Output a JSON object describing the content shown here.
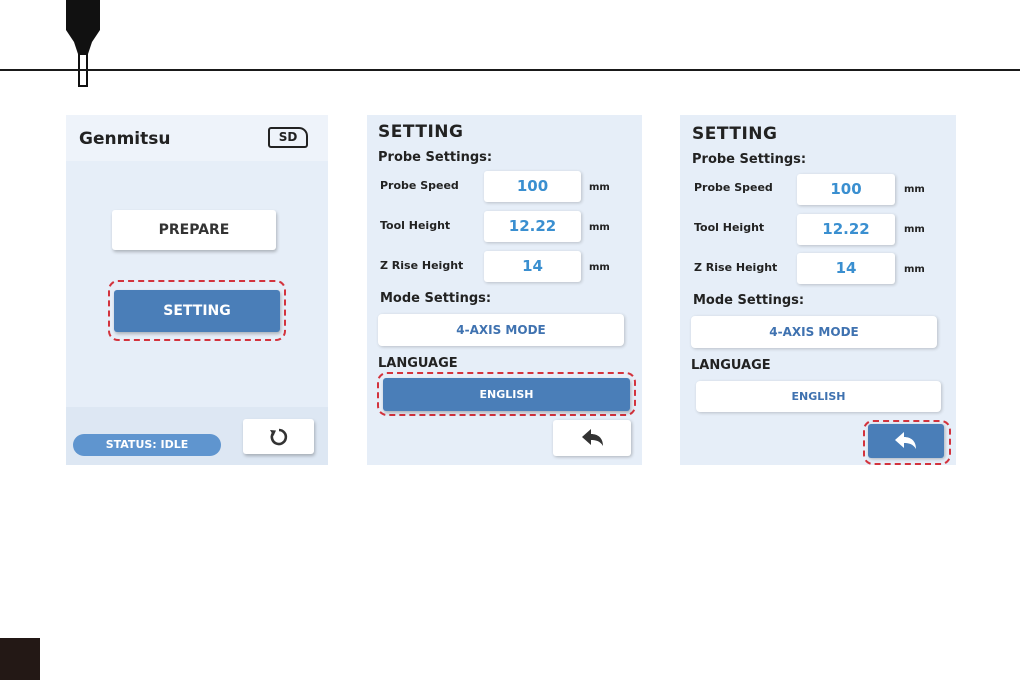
{
  "home": {
    "brand": "Genmitsu",
    "sd_badge": "SD",
    "prepare_label": "PREPARE",
    "setting_label": "SETTING",
    "status_label": "STATUS: IDLE",
    "refresh_icon": "refresh-icon"
  },
  "setting_screens": [
    {
      "title": "SETTING",
      "probe_heading": "Probe Settings:",
      "rows": [
        {
          "label": "Probe Speed",
          "value": "100",
          "unit": "mm"
        },
        {
          "label": "Tool Height",
          "value": "12.22",
          "unit": "mm"
        },
        {
          "label": "Z Rise Height",
          "value": "14",
          "unit": "mm"
        }
      ],
      "mode_heading": "Mode Settings:",
      "mode_value": "4-AXIS MODE",
      "language_heading": "LANGUAGE",
      "language_value": "ENGLISH",
      "back_icon": "back-arrow-icon"
    },
    {
      "title": "SETTING",
      "probe_heading": "Probe Settings:",
      "rows": [
        {
          "label": "Probe Speed",
          "value": "100",
          "unit": "mm"
        },
        {
          "label": "Tool Height",
          "value": "12.22",
          "unit": "mm"
        },
        {
          "label": "Z Rise Height",
          "value": "14",
          "unit": "mm"
        }
      ],
      "mode_heading": "Mode Settings:",
      "mode_value": "4-AXIS MODE",
      "language_heading": "LANGUAGE",
      "language_value": "ENGLISH",
      "back_icon": "back-arrow-icon"
    }
  ],
  "colors": {
    "screen_bg": "#e6eef8",
    "accent_blue": "#4a7eb8",
    "value_blue": "#3a8fd0",
    "highlight_red": "#d3333d",
    "status_blue": "#5f95cf"
  }
}
